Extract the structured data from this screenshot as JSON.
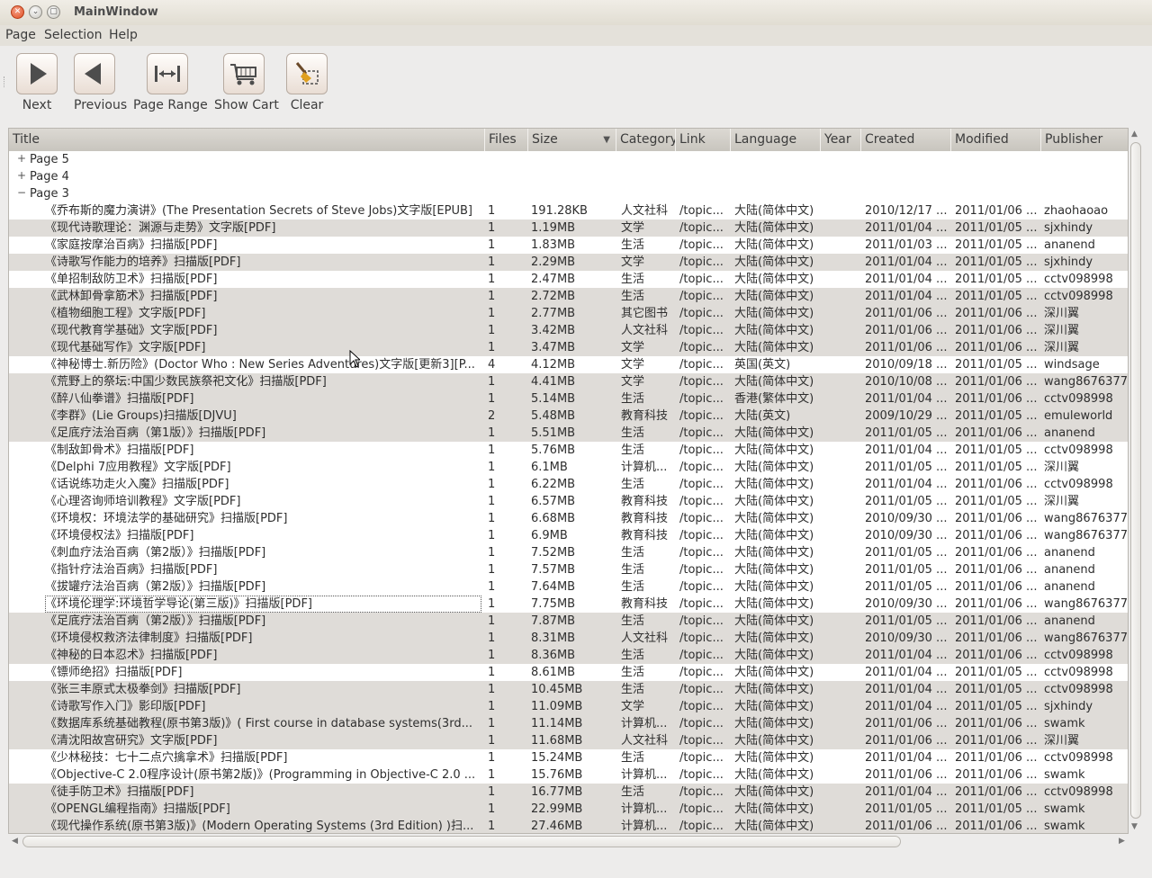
{
  "window": {
    "title": "MainWindow"
  },
  "menu": [
    "Page",
    "Selection",
    "Help"
  ],
  "toolbar": [
    {
      "label": "Next",
      "icon": "play-right-icon"
    },
    {
      "label": "Previous",
      "icon": "play-left-icon"
    },
    {
      "label": "Page Range",
      "icon": "range-icon"
    },
    {
      "label": "Show Cart",
      "icon": "cart-icon"
    },
    {
      "label": "Clear",
      "icon": "broom-icon"
    }
  ],
  "columns": [
    "Title",
    "Files",
    "Size",
    "Category",
    "Link",
    "Language",
    "Year",
    "Created",
    "Modified",
    "Publisher"
  ],
  "groups": [
    {
      "label": "Page 5",
      "expander": "+"
    },
    {
      "label": "Page 4",
      "expander": "+"
    },
    {
      "label": "Page 3",
      "expander": "−"
    }
  ],
  "rows": [
    [
      "《乔布斯的魔力演讲》(The Presentation Secrets of Steve Jobs)文字版[EPUB]",
      "1",
      "191.28KB",
      "人文社科",
      "/topic...",
      "大陆(简体中文)",
      "",
      "2010/12/17 ...",
      "2011/01/06 ...",
      "zhaohaoao"
    ],
    [
      "《现代诗歌理论：渊源与走势》文字版[PDF]",
      "1",
      "1.19MB",
      "文学",
      "/topic...",
      "大陆(简体中文)",
      "",
      "2011/01/04 ...",
      "2011/01/05 ...",
      "sjxhindy"
    ],
    [
      "《家庭按摩治百病》扫描版[PDF]",
      "1",
      "1.83MB",
      "生活",
      "/topic...",
      "大陆(简体中文)",
      "",
      "2011/01/03 ...",
      "2011/01/05 ...",
      "ananend"
    ],
    [
      "《诗歌写作能力的培养》扫描版[PDF]",
      "1",
      "2.29MB",
      "文学",
      "/topic...",
      "大陆(简体中文)",
      "",
      "2011/01/04 ...",
      "2011/01/05 ...",
      "sjxhindy"
    ],
    [
      "《单招制敌防卫术》扫描版[PDF]",
      "1",
      "2.47MB",
      "生活",
      "/topic...",
      "大陆(简体中文)",
      "",
      "2011/01/04 ...",
      "2011/01/05 ...",
      "cctv098998"
    ],
    [
      "《武林卸骨拿筋术》扫描版[PDF]",
      "1",
      "2.72MB",
      "生活",
      "/topic...",
      "大陆(简体中文)",
      "",
      "2011/01/04 ...",
      "2011/01/05 ...",
      "cctv098998"
    ],
    [
      "《植物细胞工程》文字版[PDF]",
      "1",
      "2.77MB",
      "其它图书",
      "/topic...",
      "大陆(简体中文)",
      "",
      "2011/01/06 ...",
      "2011/01/06 ...",
      "深川翼"
    ],
    [
      "《现代教育学基础》文字版[PDF]",
      "1",
      "3.42MB",
      "人文社科",
      "/topic...",
      "大陆(简体中文)",
      "",
      "2011/01/06 ...",
      "2011/01/06 ...",
      "深川翼"
    ],
    [
      "《现代基础写作》文字版[PDF]",
      "1",
      "3.47MB",
      "文学",
      "/topic...",
      "大陆(简体中文)",
      "",
      "2011/01/06 ...",
      "2011/01/06 ...",
      "深川翼"
    ],
    [
      "《神秘博士.新历险》(Doctor Who : New Series Adventures)文字版[更新3][P...",
      "4",
      "4.12MB",
      "文学",
      "/topic...",
      "英国(英文)",
      "",
      "2010/09/18 ...",
      "2011/01/05 ...",
      "windsage"
    ],
    [
      "《荒野上的祭坛:中国少数民族祭祀文化》扫描版[PDF]",
      "1",
      "4.41MB",
      "文学",
      "/topic...",
      "大陆(简体中文)",
      "",
      "2010/10/08 ...",
      "2011/01/06 ...",
      "wang8676377"
    ],
    [
      "《醉八仙拳谱》扫描版[PDF]",
      "1",
      "5.14MB",
      "生活",
      "/topic...",
      "香港(繁体中文)",
      "",
      "2011/01/04 ...",
      "2011/01/06 ...",
      "cctv098998"
    ],
    [
      "《李群》(Lie Groups)扫描版[DJVU]",
      "2",
      "5.48MB",
      "教育科技",
      "/topic...",
      "大陆(英文)",
      "",
      "2009/10/29 ...",
      "2011/01/05 ...",
      "emuleworld"
    ],
    [
      "《足底疗法治百病（第1版）》扫描版[PDF]",
      "1",
      "5.51MB",
      "生活",
      "/topic...",
      "大陆(简体中文)",
      "",
      "2011/01/05 ...",
      "2011/01/06 ...",
      "ananend"
    ],
    [
      "《制敌卸骨术》扫描版[PDF]",
      "1",
      "5.76MB",
      "生活",
      "/topic...",
      "大陆(简体中文)",
      "",
      "2011/01/04 ...",
      "2011/01/05 ...",
      "cctv098998"
    ],
    [
      "《Delphi 7应用教程》文字版[PDF]",
      "1",
      "6.1MB",
      "计算机...",
      "/topic...",
      "大陆(简体中文)",
      "",
      "2011/01/05 ...",
      "2011/01/05 ...",
      "深川翼"
    ],
    [
      "《话说练功走火入魔》扫描版[PDF]",
      "1",
      "6.22MB",
      "生活",
      "/topic...",
      "大陆(简体中文)",
      "",
      "2011/01/04 ...",
      "2011/01/06 ...",
      "cctv098998"
    ],
    [
      "《心理咨询师培训教程》文字版[PDF]",
      "1",
      "6.57MB",
      "教育科技",
      "/topic...",
      "大陆(简体中文)",
      "",
      "2011/01/05 ...",
      "2011/01/05 ...",
      "深川翼"
    ],
    [
      "《环境权：环境法学的基础研究》扫描版[PDF]",
      "1",
      "6.68MB",
      "教育科技",
      "/topic...",
      "大陆(简体中文)",
      "",
      "2010/09/30 ...",
      "2011/01/06 ...",
      "wang8676377"
    ],
    [
      "《环境侵权法》扫描版[PDF]",
      "1",
      "6.9MB",
      "教育科技",
      "/topic...",
      "大陆(简体中文)",
      "",
      "2010/09/30 ...",
      "2011/01/06 ...",
      "wang8676377"
    ],
    [
      "《刺血疗法治百病（第2版）》扫描版[PDF]",
      "1",
      "7.52MB",
      "生活",
      "/topic...",
      "大陆(简体中文)",
      "",
      "2011/01/05 ...",
      "2011/01/06 ...",
      "ananend"
    ],
    [
      "《指针疗法治百病》扫描版[PDF]",
      "1",
      "7.57MB",
      "生活",
      "/topic...",
      "大陆(简体中文)",
      "",
      "2011/01/05 ...",
      "2011/01/06 ...",
      "ananend"
    ],
    [
      "《拔罐疗法治百病（第2版）》扫描版[PDF]",
      "1",
      "7.64MB",
      "生活",
      "/topic...",
      "大陆(简体中文)",
      "",
      "2011/01/05 ...",
      "2011/01/06 ...",
      "ananend"
    ],
    [
      "《环境伦理学:环境哲学导论(第三版)》扫描版[PDF]",
      "1",
      "7.75MB",
      "教育科技",
      "/topic...",
      "大陆(简体中文)",
      "",
      "2010/09/30 ...",
      "2011/01/06 ...",
      "wang8676377"
    ],
    [
      "《足底疗法治百病（第2版）》扫描版[PDF]",
      "1",
      "7.87MB",
      "生活",
      "/topic...",
      "大陆(简体中文)",
      "",
      "2011/01/05 ...",
      "2011/01/06 ...",
      "ananend"
    ],
    [
      "《环境侵权救济法律制度》扫描版[PDF]",
      "1",
      "8.31MB",
      "人文社科",
      "/topic...",
      "大陆(简体中文)",
      "",
      "2010/09/30 ...",
      "2011/01/06 ...",
      "wang8676377"
    ],
    [
      "《神秘的日本忍术》扫描版[PDF]",
      "1",
      "8.36MB",
      "生活",
      "/topic...",
      "大陆(简体中文)",
      "",
      "2011/01/04 ...",
      "2011/01/06 ...",
      "cctv098998"
    ],
    [
      "《镖师绝招》扫描版[PDF]",
      "1",
      "8.61MB",
      "生活",
      "/topic...",
      "大陆(简体中文)",
      "",
      "2011/01/04 ...",
      "2011/01/05 ...",
      "cctv098998"
    ],
    [
      "《张三丰原式太极拳剑》扫描版[PDF]",
      "1",
      "10.45MB",
      "生活",
      "/topic...",
      "大陆(简体中文)",
      "",
      "2011/01/04 ...",
      "2011/01/05 ...",
      "cctv098998"
    ],
    [
      "《诗歌写作入门》影印版[PDF]",
      "1",
      "11.09MB",
      "文学",
      "/topic...",
      "大陆(简体中文)",
      "",
      "2011/01/04 ...",
      "2011/01/05 ...",
      "sjxhindy"
    ],
    [
      "《数据库系统基础教程(原书第3版)》( First course in database systems(3rd...",
      "1",
      "11.14MB",
      "计算机...",
      "/topic...",
      "大陆(简体中文)",
      "",
      "2011/01/06 ...",
      "2011/01/06 ...",
      "swamk"
    ],
    [
      "《清沈阳故宫研究》文字版[PDF]",
      "1",
      "11.68MB",
      "人文社科",
      "/topic...",
      "大陆(简体中文)",
      "",
      "2011/01/06 ...",
      "2011/01/06 ...",
      "深川翼"
    ],
    [
      "《少林秘技：七十二点穴擒拿术》扫描版[PDF]",
      "1",
      "15.24MB",
      "生活",
      "/topic...",
      "大陆(简体中文)",
      "",
      "2011/01/04 ...",
      "2011/01/06 ...",
      "cctv098998"
    ],
    [
      "《Objective-C 2.0程序设计(原书第2版)》(Programming in Objective-C 2.0 ...",
      "1",
      "15.76MB",
      "计算机...",
      "/topic...",
      "大陆(简体中文)",
      "",
      "2011/01/06 ...",
      "2011/01/06 ...",
      "swamk"
    ],
    [
      "《徒手防卫术》扫描版[PDF]",
      "1",
      "16.77MB",
      "生活",
      "/topic...",
      "大陆(简体中文)",
      "",
      "2011/01/04 ...",
      "2011/01/06 ...",
      "cctv098998"
    ],
    [
      "《OPENGL编程指南》扫描版[PDF]",
      "1",
      "22.99MB",
      "计算机...",
      "/topic...",
      "大陆(简体中文)",
      "",
      "2011/01/05 ...",
      "2011/01/05 ...",
      "swamk"
    ],
    [
      "《现代操作系统(原书第3版)》(Modern Operating Systems (3rd Edition) )扫...",
      "1",
      "27.46MB",
      "计算机...",
      "/topic...",
      "大陆(简体中文)",
      "",
      "2011/01/06 ...",
      "2011/01/06 ...",
      "swamk"
    ]
  ],
  "alt_rows": [
    1,
    3,
    5,
    6,
    7,
    8,
    10,
    11,
    12,
    13,
    24,
    25,
    26,
    28,
    29,
    30,
    31,
    34,
    35,
    36
  ]
}
